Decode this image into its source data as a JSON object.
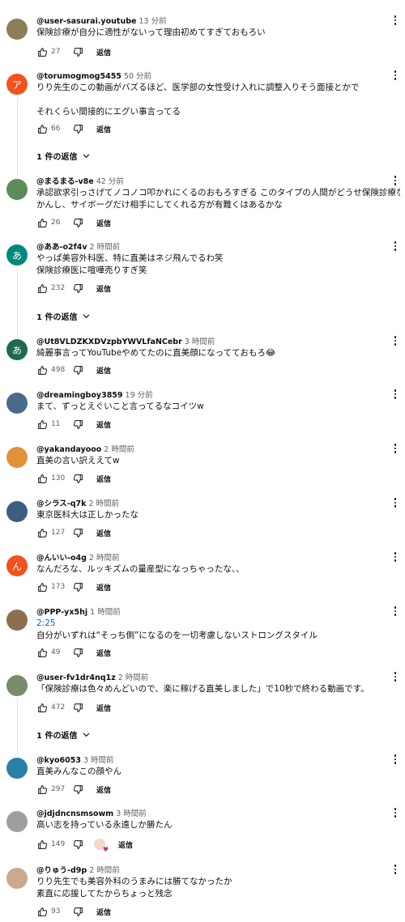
{
  "reply_label": "返信",
  "comments": [
    {
      "author": "@user-sasurai.youtube",
      "time": "13 分前",
      "avatar_color": "#8a7f5a",
      "avatar_letter": "",
      "lines": [
        "保険診療が自分に適性がないって理由初めてすぎておもろい"
      ],
      "likes": "27",
      "replies_toggle": null,
      "creator_heart": false
    },
    {
      "author": "@torumogmog5455",
      "time": "50 分前",
      "avatar_color": "#f4511e",
      "avatar_letter": "ア",
      "lines": [
        "りり先生のこの動画がバズるほど、医学部の女性受け入れに調整入りそう面接とかで",
        "",
        "それくらい間接的にエグい事言ってる"
      ],
      "likes": "66",
      "replies_toggle": "1 件の返信",
      "creator_heart": false
    },
    {
      "author": "@まるまる-v8e",
      "time": "42 分前",
      "avatar_color": "#5b8c5a",
      "avatar_letter": "",
      "lines": [
        "承認欲求引っさげてノコノコ叩かれにくるのおもろすぎる このタイプの人間がどうせ保険診療など続",
        "かんし、サイボーグだけ相手にしてくれる方が有難くはあるかな"
      ],
      "likes": "26",
      "replies_toggle": null,
      "creator_heart": false
    },
    {
      "author": "@ああ-o2f4v",
      "time": "2 時間前",
      "avatar_color": "#00897b",
      "avatar_letter": "あ",
      "lines": [
        "やっぱ美容外科医、特に直美はネジ飛んでるわ笑",
        "保険診療医に喧嘩売りすぎ笑"
      ],
      "likes": "232",
      "replies_toggle": "1 件の返信",
      "creator_heart": false
    },
    {
      "author": "@Ut8VLDZKXDVzpbYWVLfaNCebr",
      "time": "3 時間前",
      "avatar_color": "#1e6b4f",
      "avatar_letter": "あ",
      "lines": [
        "綺麗事言ってYouTubeやめてたのに直美顔になってておもろ😂"
      ],
      "likes": "498",
      "replies_toggle": null,
      "creator_heart": false
    },
    {
      "author": "@dreamingboy3859",
      "time": "19 分前",
      "avatar_color": "#4a6a8a",
      "avatar_letter": "",
      "lines": [
        "まて、ずっとえぐいこと言ってるなコイツw"
      ],
      "likes": "11",
      "replies_toggle": null,
      "creator_heart": false
    },
    {
      "author": "@yakandayooo",
      "time": "2 時間前",
      "avatar_color": "#e0913a",
      "avatar_letter": "",
      "lines": [
        "直美の言い訳ええてw"
      ],
      "likes": "130",
      "replies_toggle": null,
      "creator_heart": false
    },
    {
      "author": "@シラス-q7k",
      "time": "2 時間前",
      "avatar_color": "#3c5f80",
      "avatar_letter": "",
      "lines": [
        "東京医科大は正しかったな"
      ],
      "likes": "127",
      "replies_toggle": null,
      "creator_heart": false
    },
    {
      "author": "@んいい-o4g",
      "time": "2 時間前",
      "avatar_color": "#f4511e",
      "avatar_letter": "ん",
      "lines": [
        "なんだろな、ルッキズムの量産型になっちゃったな、、"
      ],
      "likes": "173",
      "replies_toggle": null,
      "creator_heart": false
    },
    {
      "author": "@PPP-yx5hj",
      "time": "1 時間前",
      "avatar_color": "#8d6e4f",
      "avatar_letter": "",
      "timestamp_link": "2:25",
      "lines": [
        "自分がいずれは“そっち側”になるのを一切考慮しないストロングスタイル"
      ],
      "likes": "49",
      "replies_toggle": null,
      "creator_heart": false
    },
    {
      "author": "@user-fv1dr4nq1z",
      "time": "2 時間前",
      "avatar_color": "#7a8c6a",
      "avatar_letter": "",
      "lines": [
        "「保険診療は色々めんどいので、楽に稼げる直美しました」で10秒で終わる動画です。"
      ],
      "likes": "472",
      "replies_toggle": "1 件の返信",
      "creator_heart": false
    },
    {
      "author": "@kyo6053",
      "time": "3 時間前",
      "avatar_color": "#2a7fa8",
      "avatar_letter": "",
      "lines": [
        "直美みんなこの顔やん"
      ],
      "likes": "297",
      "replies_toggle": null,
      "creator_heart": false
    },
    {
      "author": "@jdjdncnsmsowm",
      "time": "3 時間前",
      "avatar_color": "#9e9e9e",
      "avatar_letter": "",
      "lines": [
        "高い志を持っている永遠しか勝たん"
      ],
      "likes": "149",
      "replies_toggle": null,
      "creator_heart": true
    },
    {
      "author": "@りゅう-d9p",
      "time": "2 時間前",
      "avatar_color": "#c9a98f",
      "avatar_letter": "",
      "lines": [
        "りり先生でも美容外科のうまみには勝てなかったか",
        "素直に応援してたからちょっと残念"
      ],
      "likes": "93",
      "replies_toggle": null,
      "creator_heart": false
    }
  ]
}
